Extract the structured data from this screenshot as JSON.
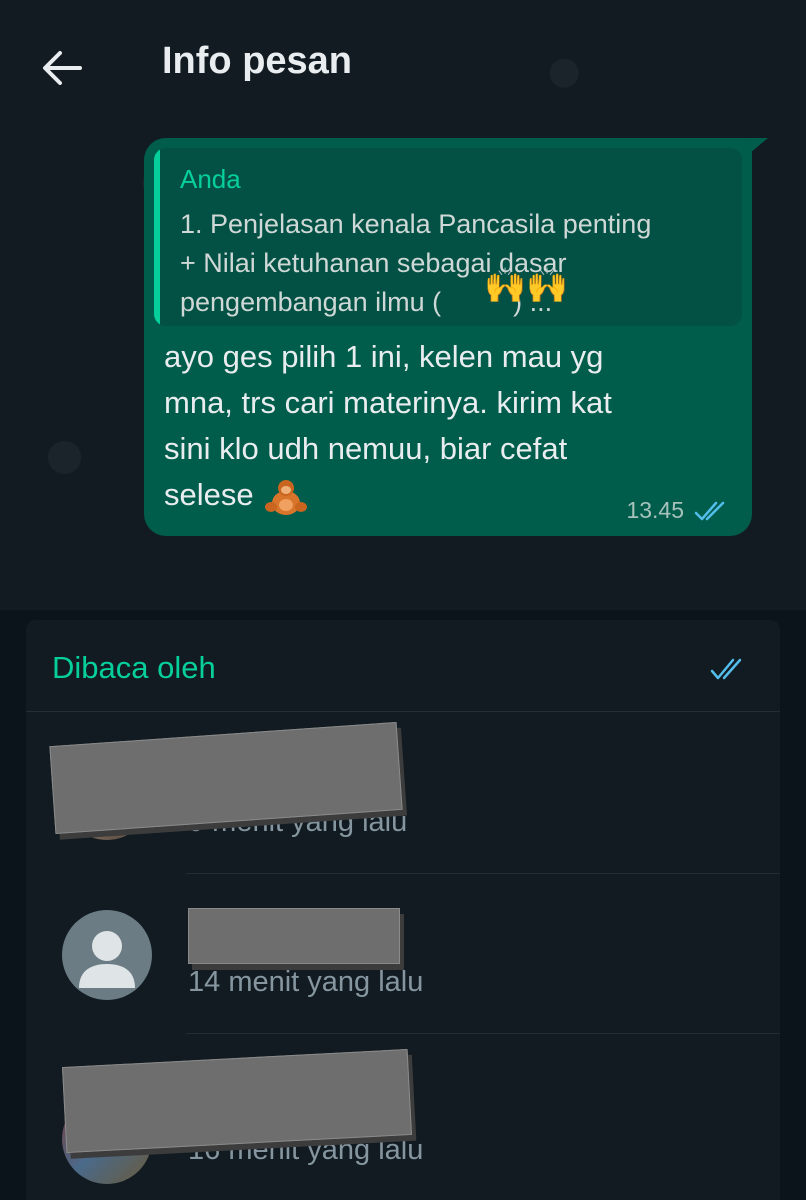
{
  "header": {
    "title": "Info pesan"
  },
  "message": {
    "quote": {
      "author": "Anda",
      "lines": [
        "1. Penjelasan kenala Pancasila penting",
        "+ Nilai ketuhanan sebagai dasar",
        "pengembangan ilmu (",
        ") ..."
      ],
      "emoji": "🙌"
    },
    "text_lines": [
      "ayo ges pilih 1 ini, kelen mau yg",
      "mna, trs cari materinya. kirim kat",
      "sini klo udh nemuu, biar cefat",
      "selese"
    ],
    "time": "13.45",
    "status_icon": "double-check-icon"
  },
  "read_by": {
    "title": "Dibaca oleh",
    "readers": [
      {
        "time": "9 menit yang lalu",
        "avatar": "photo"
      },
      {
        "time": "14 menit yang lalu",
        "avatar": "default-person-icon"
      },
      {
        "time": "16 menit yang lalu",
        "avatar": "photo"
      }
    ]
  },
  "colors": {
    "accent": "#06cf9c",
    "bubble": "#005c4b",
    "read_check": "#53bdeb",
    "background": "#111b21"
  }
}
